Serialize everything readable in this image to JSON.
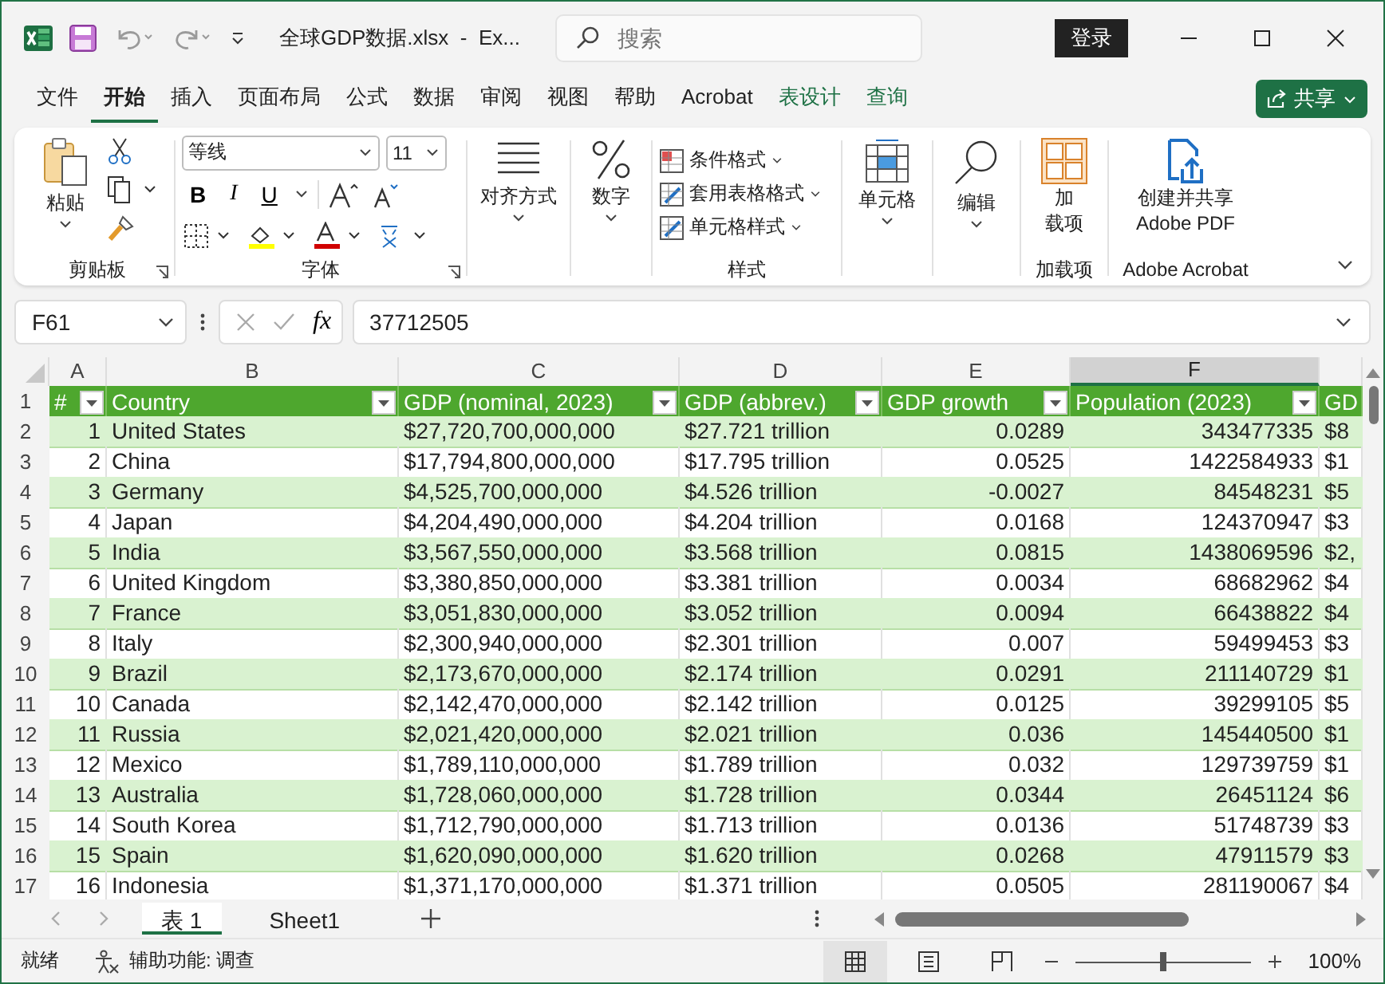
{
  "title_bar": {
    "title": "全球GDP数据.xlsx  -  Ex...",
    "search_placeholder": "搜索",
    "login": "登录"
  },
  "menu_tabs": [
    {
      "label": "文件",
      "selected": false,
      "contextual": false
    },
    {
      "label": "开始",
      "selected": true,
      "contextual": false
    },
    {
      "label": "插入",
      "selected": false,
      "contextual": false
    },
    {
      "label": "页面布局",
      "selected": false,
      "contextual": false
    },
    {
      "label": "公式",
      "selected": false,
      "contextual": false
    },
    {
      "label": "数据",
      "selected": false,
      "contextual": false
    },
    {
      "label": "审阅",
      "selected": false,
      "contextual": false
    },
    {
      "label": "视图",
      "selected": false,
      "contextual": false
    },
    {
      "label": "帮助",
      "selected": false,
      "contextual": false
    },
    {
      "label": "Acrobat",
      "selected": false,
      "contextual": false
    },
    {
      "label": "表设计",
      "selected": false,
      "contextual": true
    },
    {
      "label": "查询",
      "selected": false,
      "contextual": true
    }
  ],
  "share": "共享",
  "ribbon": {
    "clipboard": {
      "paste": "粘贴",
      "label": "剪贴板"
    },
    "font": {
      "font_name": "等线",
      "font_size": "11",
      "bold": "B",
      "italic": "I",
      "underline": "U",
      "label": "字体"
    },
    "alignment": "对齐方式",
    "number": "数字",
    "styles": {
      "items": [
        "条件格式",
        "套用表格格式",
        "单元格样式"
      ],
      "label": "样式"
    },
    "cells": "单元格",
    "editing": "编辑",
    "addins": {
      "button_lines": [
        "加",
        "载项"
      ],
      "label": "加载项"
    },
    "adobe": {
      "button_lines": [
        "创建并共享",
        "Adobe PDF"
      ],
      "label": "Adobe Acrobat"
    }
  },
  "formula_bar": {
    "name_box": "F61",
    "function_button": "fx",
    "value": "37712505"
  },
  "column_letters": [
    {
      "label": "A",
      "selected": false
    },
    {
      "label": "B",
      "selected": false
    },
    {
      "label": "C",
      "selected": false
    },
    {
      "label": "D",
      "selected": false
    },
    {
      "label": "E",
      "selected": false
    },
    {
      "label": "F",
      "selected": true
    }
  ],
  "row_numbers": [
    "1",
    "2",
    "3",
    "4",
    "5",
    "6",
    "7",
    "8",
    "9",
    "10",
    "11",
    "12",
    "13",
    "14",
    "15",
    "16",
    "17"
  ],
  "table": {
    "columns": [
      "#",
      "Country",
      "GDP (nominal, 2023)",
      "GDP (abbrev.)",
      "GDP growth",
      "Population (2023)",
      "GD"
    ],
    "rows": [
      [
        "1",
        "United States",
        "$27,720,700,000,000",
        "$27.721 trillion",
        "0.0289",
        "343477335",
        "$8"
      ],
      [
        "2",
        "China",
        "$17,794,800,000,000",
        "$17.795 trillion",
        "0.0525",
        "1422584933",
        "$1"
      ],
      [
        "3",
        "Germany",
        "$4,525,700,000,000",
        "$4.526 trillion",
        "-0.0027",
        "84548231",
        "$5"
      ],
      [
        "4",
        "Japan",
        "$4,204,490,000,000",
        "$4.204 trillion",
        "0.0168",
        "124370947",
        "$3"
      ],
      [
        "5",
        "India",
        "$3,567,550,000,000",
        "$3.568 trillion",
        "0.0815",
        "1438069596",
        "$2,"
      ],
      [
        "6",
        "United Kingdom",
        "$3,380,850,000,000",
        "$3.381 trillion",
        "0.0034",
        "68682962",
        "$4"
      ],
      [
        "7",
        "France",
        "$3,051,830,000,000",
        "$3.052 trillion",
        "0.0094",
        "66438822",
        "$4"
      ],
      [
        "8",
        "Italy",
        "$2,300,940,000,000",
        "$2.301 trillion",
        "0.007",
        "59499453",
        "$3"
      ],
      [
        "9",
        "Brazil",
        "$2,173,670,000,000",
        "$2.174 trillion",
        "0.0291",
        "211140729",
        "$1"
      ],
      [
        "10",
        "Canada",
        "$2,142,470,000,000",
        "$2.142 trillion",
        "0.0125",
        "39299105",
        "$5"
      ],
      [
        "11",
        "Russia",
        "$2,021,420,000,000",
        "$2.021 trillion",
        "0.036",
        "145440500",
        "$1"
      ],
      [
        "12",
        "Mexico",
        "$1,789,110,000,000",
        "$1.789 trillion",
        "0.032",
        "129739759",
        "$1"
      ],
      [
        "13",
        "Australia",
        "$1,728,060,000,000",
        "$1.728 trillion",
        "0.0344",
        "26451124",
        "$6"
      ],
      [
        "14",
        "South Korea",
        "$1,712,790,000,000",
        "$1.713 trillion",
        "0.0136",
        "51748739",
        "$3"
      ],
      [
        "15",
        "Spain",
        "$1,620,090,000,000",
        "$1.620 trillion",
        "0.0268",
        "47911579",
        "$3"
      ],
      [
        "16",
        "Indonesia",
        "$1,371,170,000,000",
        "$1.371 trillion",
        "0.0505",
        "281190067",
        "$4"
      ]
    ]
  },
  "sheet_tabs": [
    {
      "label": "表 1",
      "selected": true
    },
    {
      "label": "Sheet1",
      "selected": false
    }
  ],
  "status_bar": {
    "status": "就绪",
    "accessibility": "辅助功能: 调查",
    "views": [
      {
        "kind": "normal",
        "selected": true
      },
      {
        "kind": "page_layout",
        "selected": false
      },
      {
        "kind": "page_break",
        "selected": false
      }
    ],
    "zoom": {
      "level": 0.5,
      "reading": "100%"
    }
  }
}
